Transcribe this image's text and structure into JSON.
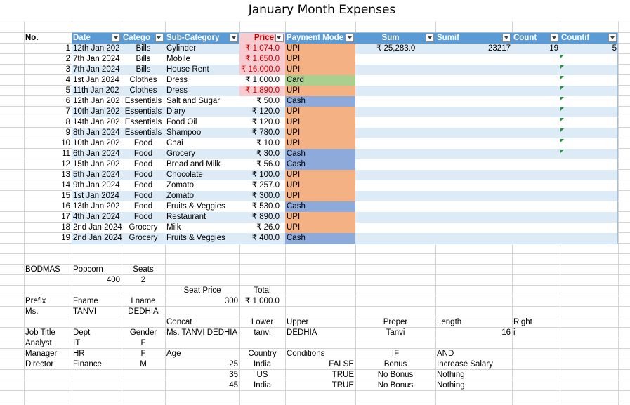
{
  "title": "January Month Expenses",
  "headers": {
    "no": "No.",
    "date": "Date",
    "category": "Catego",
    "subcategory": "Sub-Category",
    "price": "Price",
    "payment": "Payment Mode",
    "sum": "Sum",
    "sumif": "Sumif",
    "count": "Count",
    "countif": "Countif"
  },
  "rows": [
    {
      "no": "1",
      "date": "12th Jan 202",
      "cat": "Bills",
      "sub": "Cylinder",
      "price": "₹ 1,074.0",
      "pay": "UPI"
    },
    {
      "no": "2",
      "date": "7th Jan 2024",
      "cat": "Bills",
      "sub": "Mobile",
      "price": "₹ 1,650.0",
      "pay": "UPI"
    },
    {
      "no": "3",
      "date": "7th Jan 2024",
      "cat": "Bills",
      "sub": "House Rent",
      "price": "₹ 16,000.0",
      "pay": "UPI"
    },
    {
      "no": "4",
      "date": "1st Jan 2024",
      "cat": "Clothes",
      "sub": "Dress",
      "price": "₹ 1,000.0",
      "pay": "Card"
    },
    {
      "no": "5",
      "date": "11th Jan 202",
      "cat": "Clothes",
      "sub": "Dress",
      "price": "₹ 1,890.0",
      "pay": "UPI"
    },
    {
      "no": "6",
      "date": "12th Jan 202",
      "cat": "Essentials",
      "sub": "Salt and Sugar",
      "price": "₹ 50.0",
      "pay": "Cash"
    },
    {
      "no": "7",
      "date": "10th Jan 202",
      "cat": "Essentials",
      "sub": "Diary",
      "price": "₹ 120.0",
      "pay": "UPI"
    },
    {
      "no": "8",
      "date": "14th Jan 202",
      "cat": "Essentials",
      "sub": "Food Oil",
      "price": "₹ 120.0",
      "pay": "UPI"
    },
    {
      "no": "9",
      "date": "8th Jan 2024",
      "cat": "Essentials",
      "sub": "Shampoo",
      "price": "₹ 780.0",
      "pay": "UPI"
    },
    {
      "no": "10",
      "date": "10th Jan 202",
      "cat": "Food",
      "sub": "Chai",
      "price": "₹ 10.0",
      "pay": "UPI"
    },
    {
      "no": "11",
      "date": "6th Jan 2024",
      "cat": "Food",
      "sub": "Grocery",
      "price": "₹ 30.0",
      "pay": "Cash"
    },
    {
      "no": "12",
      "date": "15th Jan 202",
      "cat": "Food",
      "sub": "Bread and Milk",
      "price": "₹ 56.0",
      "pay": "Cash"
    },
    {
      "no": "13",
      "date": "5th Jan 2024",
      "cat": "Food",
      "sub": "Chocolate",
      "price": "₹ 100.0",
      "pay": "UPI"
    },
    {
      "no": "14",
      "date": "9th Jan 2024",
      "cat": "Food",
      "sub": "Zomato",
      "price": "₹ 257.0",
      "pay": "UPI"
    },
    {
      "no": "15",
      "date": "1st Jan 2024",
      "cat": "Food",
      "sub": "Zomato",
      "price": "₹ 300.0",
      "pay": "UPI"
    },
    {
      "no": "16",
      "date": "13th Jan 202",
      "cat": "Food",
      "sub": "Fruits & Veggies",
      "price": "₹ 530.0",
      "pay": "Cash"
    },
    {
      "no": "17",
      "date": "4th Jan 2024",
      "cat": "Food",
      "sub": "Restaurant",
      "price": "₹ 890.0",
      "pay": "UPI"
    },
    {
      "no": "18",
      "date": "2nd Jan 2024",
      "cat": "Grocery",
      "sub": "Milk",
      "price": "₹ 26.0",
      "pay": "UPI"
    },
    {
      "no": "19",
      "date": "2nd Jan 2024",
      "cat": "Grocery",
      "sub": "Fruits & Veggies",
      "price": "₹ 400.0",
      "pay": "Cash"
    }
  ],
  "summary": {
    "sum": "₹ 25,283.0",
    "sumif": "23217",
    "count": "19",
    "countif": "5"
  },
  "lower": [
    {
      "text": "BODMAS",
      "col": 0,
      "row": 22,
      "align": "left"
    },
    {
      "text": "Popcorn",
      "col": 1,
      "row": 22,
      "align": "left"
    },
    {
      "text": "Seats",
      "col": 2,
      "row": 22,
      "align": "center"
    },
    {
      "text": "400",
      "col": 1,
      "row": 23,
      "align": "right"
    },
    {
      "text": "2",
      "col": 2,
      "row": 23,
      "align": "center"
    },
    {
      "text": "Seat Price",
      "col": 3,
      "row": 24,
      "align": "center"
    },
    {
      "text": "Total",
      "col": 4,
      "row": 24,
      "align": "center"
    },
    {
      "text": "Prefix",
      "col": 0,
      "row": 25,
      "align": "left"
    },
    {
      "text": "Fname",
      "col": 1,
      "row": 25,
      "align": "left"
    },
    {
      "text": "Lname",
      "col": 2,
      "row": 25,
      "align": "center"
    },
    {
      "text": "300",
      "col": 3,
      "row": 25,
      "align": "right"
    },
    {
      "text": "₹ 1,000.0",
      "col": 4,
      "row": 25,
      "align": "center"
    },
    {
      "text": "Ms.",
      "col": 0,
      "row": 26,
      "align": "left"
    },
    {
      "text": "TANVI",
      "col": 1,
      "row": 26,
      "align": "left"
    },
    {
      "text": "DEDHIA",
      "col": 2,
      "row": 26,
      "align": "center"
    },
    {
      "text": "Concat",
      "col": 3,
      "row": 27,
      "align": "left"
    },
    {
      "text": "Lower",
      "col": 4,
      "row": 27,
      "align": "center"
    },
    {
      "text": "Upper",
      "col": 5,
      "row": 27,
      "align": "left"
    },
    {
      "text": "Proper",
      "col": 6,
      "row": 27,
      "align": "center"
    },
    {
      "text": "Length",
      "col": 7,
      "row": 27,
      "align": "left"
    },
    {
      "text": "Right",
      "col": 8,
      "row": 27,
      "align": "left"
    },
    {
      "text": "Job Title",
      "col": 0,
      "row": 28,
      "align": "left"
    },
    {
      "text": "Dept",
      "col": 1,
      "row": 28,
      "align": "left"
    },
    {
      "text": "Gender",
      "col": 2,
      "row": 28,
      "align": "center"
    },
    {
      "text": "Ms. TANVI DEDHIA",
      "col": 3,
      "row": 28,
      "align": "left"
    },
    {
      "text": "tanvi",
      "col": 4,
      "row": 28,
      "align": "center"
    },
    {
      "text": "DEDHIA",
      "col": 5,
      "row": 28,
      "align": "left"
    },
    {
      "text": "Tanvi",
      "col": 6,
      "row": 28,
      "align": "center"
    },
    {
      "text": "16",
      "col": 7,
      "row": 28,
      "align": "right"
    },
    {
      "text": "i",
      "col": 8,
      "row": 28,
      "align": "left"
    },
    {
      "text": "Analyst",
      "col": 0,
      "row": 29,
      "align": "left"
    },
    {
      "text": "IT",
      "col": 1,
      "row": 29,
      "align": "left"
    },
    {
      "text": "F",
      "col": 2,
      "row": 29,
      "align": "center"
    },
    {
      "text": "Manager",
      "col": 0,
      "row": 30,
      "align": "left"
    },
    {
      "text": "HR",
      "col": 1,
      "row": 30,
      "align": "left"
    },
    {
      "text": "F",
      "col": 2,
      "row": 30,
      "align": "center"
    },
    {
      "text": "Age",
      "col": 3,
      "row": 30,
      "align": "left"
    },
    {
      "text": "Country",
      "col": 4,
      "row": 30,
      "align": "center"
    },
    {
      "text": "Conditions",
      "col": 5,
      "row": 30,
      "align": "left"
    },
    {
      "text": "IF",
      "col": 6,
      "row": 30,
      "align": "center"
    },
    {
      "text": "AND",
      "col": 7,
      "row": 30,
      "align": "left"
    },
    {
      "text": "Director",
      "col": 0,
      "row": 31,
      "align": "left"
    },
    {
      "text": "Finance",
      "col": 1,
      "row": 31,
      "align": "left"
    },
    {
      "text": "M",
      "col": 2,
      "row": 31,
      "align": "center"
    },
    {
      "text": "25",
      "col": 3,
      "row": 31,
      "align": "right"
    },
    {
      "text": "India",
      "col": 4,
      "row": 31,
      "align": "center"
    },
    {
      "text": "FALSE",
      "col": 5,
      "row": 31,
      "align": "right"
    },
    {
      "text": "Bonus",
      "col": 6,
      "row": 31,
      "align": "center"
    },
    {
      "text": "Increase Salary",
      "col": 7,
      "row": 31,
      "align": "left"
    },
    {
      "text": "35",
      "col": 3,
      "row": 32,
      "align": "right"
    },
    {
      "text": "US",
      "col": 4,
      "row": 32,
      "align": "center"
    },
    {
      "text": "TRUE",
      "col": 5,
      "row": 32,
      "align": "right"
    },
    {
      "text": "No Bonus",
      "col": 6,
      "row": 32,
      "align": "center"
    },
    {
      "text": "Nothing",
      "col": 7,
      "row": 32,
      "align": "left"
    },
    {
      "text": "45",
      "col": 3,
      "row": 33,
      "align": "right"
    },
    {
      "text": "India",
      "col": 4,
      "row": 33,
      "align": "center"
    },
    {
      "text": "TRUE",
      "col": 5,
      "row": 33,
      "align": "right"
    },
    {
      "text": "No Bonus",
      "col": 6,
      "row": 33,
      "align": "center"
    },
    {
      "text": "Nothing",
      "col": 7,
      "row": 33,
      "align": "left"
    }
  ],
  "colors": {
    "header": "#5b9bd5",
    "band": "#ddebf7",
    "upi": "#f4b183",
    "cash": "#8eaadb",
    "card": "#a9d08e",
    "highlight": "#f8cbd1"
  }
}
